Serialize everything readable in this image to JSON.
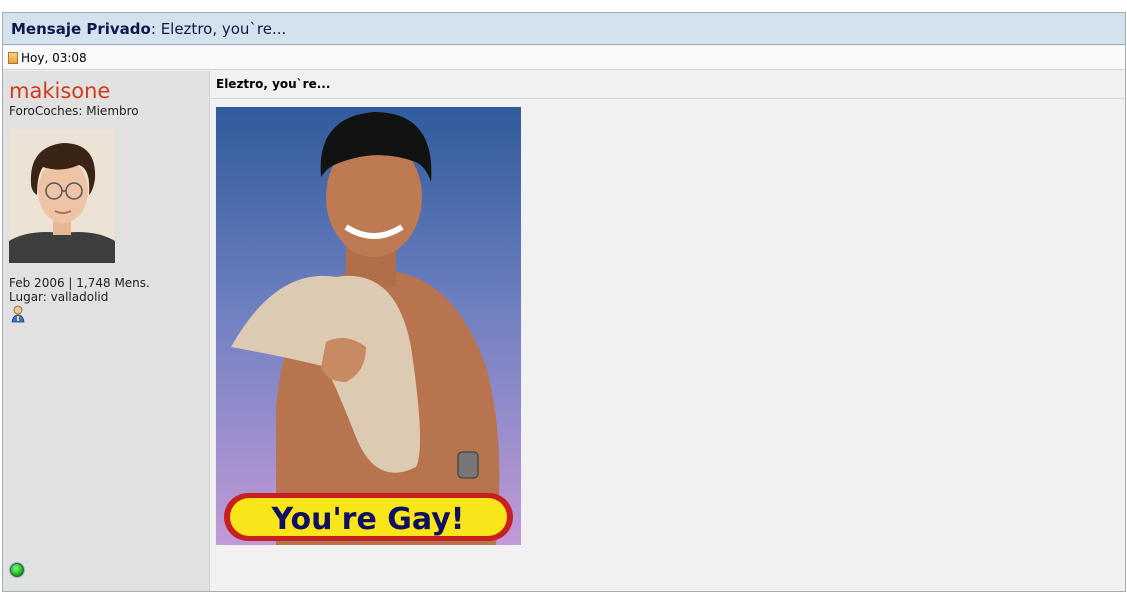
{
  "header": {
    "label": "Mensaje Privado",
    "separator": ":",
    "subject": "Eleztro, you`re..."
  },
  "meta": {
    "date_icon": "document-icon",
    "date": "Hoy, 03:08"
  },
  "user": {
    "name": "makisone",
    "title": "ForoCoches: Miembro",
    "joined_posts": "Feb 2006 | 1,748 Mens.",
    "location": "Lugar: valladolid",
    "gender_icon": "user-male-icon",
    "status_icon": "online-status-icon",
    "name_color": "#d13b1c"
  },
  "post": {
    "subject": "Eleztro, you`re...",
    "image_caption": "You're Gay!"
  },
  "colors": {
    "title_bg": "#d4e2ee",
    "user_col_bg": "#e1e1e1",
    "content_bg": "#f1f1f1"
  }
}
